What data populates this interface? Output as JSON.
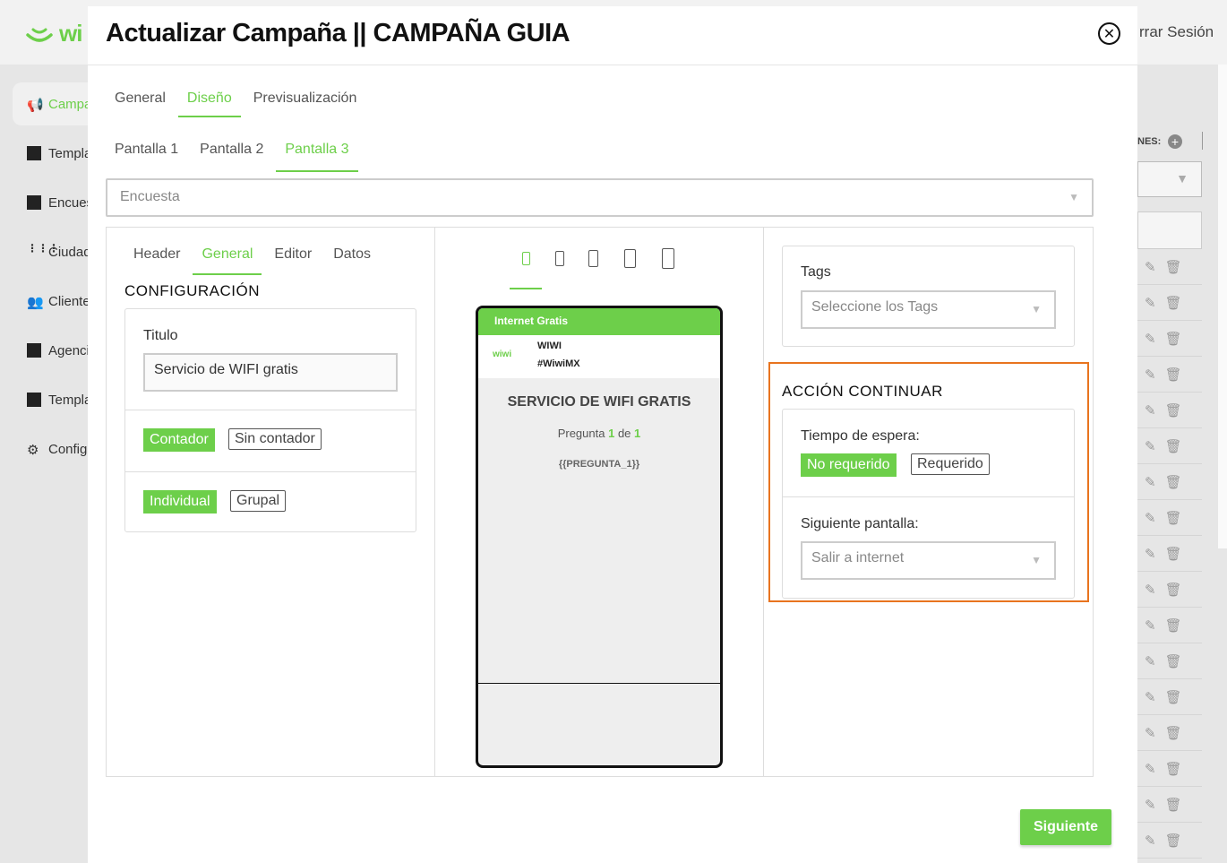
{
  "background": {
    "logo_text": "wi",
    "logout": "rrar Sesión",
    "sidebar": [
      {
        "label": "Campa",
        "icon": "megaphone-icon",
        "active": true
      },
      {
        "label": "Templa",
        "icon": "layout-icon"
      },
      {
        "label": "Encues",
        "icon": "clipboard-icon"
      },
      {
        "label": "Ciudad",
        "icon": "grid-dots-icon"
      },
      {
        "label": "Cliente",
        "icon": "users-icon"
      },
      {
        "label": "Agenci",
        "icon": "building-icon"
      },
      {
        "label": "Templa",
        "icon": "layout-icon"
      },
      {
        "label": "Config",
        "icon": "gear-icon"
      }
    ],
    "right_label": "NES:"
  },
  "modal": {
    "title": "Actualizar Campaña || CAMPAÑA GUIA",
    "tabs": [
      {
        "label": "General"
      },
      {
        "label": "Diseño",
        "active": true
      },
      {
        "label": "Previsualización"
      }
    ],
    "screen_tabs": [
      {
        "label": "Pantalla 1"
      },
      {
        "label": "Pantalla 2"
      },
      {
        "label": "Pantalla 3",
        "active": true
      }
    ],
    "type_select": "Encuesta",
    "left": {
      "tabs": [
        {
          "label": "Header"
        },
        {
          "label": "General",
          "active": true
        },
        {
          "label": "Editor"
        },
        {
          "label": "Datos"
        }
      ],
      "section_title": "CONFIGURACIÓN",
      "titulo_label": "Titulo",
      "titulo_value": "Servicio de WIFI gratis",
      "contador_on": "Contador",
      "contador_off": "Sin contador",
      "individual": "Individual",
      "grupal": "Grupal"
    },
    "preview": {
      "header_bar": "Internet Gratis",
      "brand_logo": "wiwi",
      "brand_name": "WIWI",
      "brand_tag": "#WiwiMX",
      "title": "SERVICIO DE WIFI GRATIS",
      "question_prefix": "Pregunta",
      "question_current": "1",
      "question_of": "de",
      "question_total": "1",
      "placeholder": "{{PREGUNTA_1}}"
    },
    "right": {
      "tags_label": "Tags",
      "tags_placeholder": "Seleccione los Tags",
      "action_title": "ACCIÓN CONTINUAR",
      "wait_label": "Tiempo de espera:",
      "wait_off": "No requerido",
      "wait_on": "Requerido",
      "next_screen_label": "Siguiente pantalla:",
      "next_screen_value": "Salir a internet"
    },
    "next_button": "Siguiente"
  },
  "colors": {
    "accent": "#6dcf4a",
    "highlight": "#e8741f"
  }
}
